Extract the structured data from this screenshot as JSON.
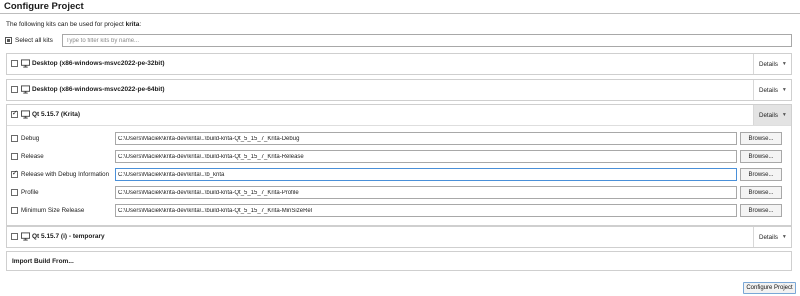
{
  "page": {
    "title": "Configure Project",
    "subtitle_prefix": "The following kits can be used for project",
    "project_name": "krita",
    "subtitle_suffix": ":"
  },
  "select_all": {
    "label": "Select all kits",
    "checked": true
  },
  "filter": {
    "placeholder": "Type to filter kits by name...",
    "value": ""
  },
  "kits": [
    {
      "name": "Desktop (x86-windows-msvc2022-pe-32bit)",
      "checked": false,
      "details_label": "Details",
      "icon": "monitor-icon"
    },
    {
      "name": "Desktop (x86-windows-msvc2022-pe-64bit)",
      "checked": false,
      "details_label": "Details",
      "icon": "monitor-icon"
    },
    {
      "name": "Qt 5.15.7 (Krita)",
      "checked": true,
      "details_label": "Details",
      "icon": "monitor-icon",
      "expanded": true,
      "configs": [
        {
          "label": "Debug",
          "checked": false,
          "path": "C:\\Users\\Maciek\\krita-dev\\krita\\..\\build-krita-Qt_5_15_7_Krita-Debug",
          "browse_label": "Browse..."
        },
        {
          "label": "Release",
          "checked": false,
          "path": "C:\\Users\\Maciek\\krita-dev\\krita\\..\\build-krita-Qt_5_15_7_Krita-Release",
          "browse_label": "Browse..."
        },
        {
          "label": "Release with Debug Information",
          "checked": true,
          "path": "C:\\Users\\Maciek\\krita-dev\\krita\\..\\b_krita",
          "browse_label": "Browse...",
          "focused": true
        },
        {
          "label": "Profile",
          "checked": false,
          "path": "C:\\Users\\Maciek\\krita-dev\\krita\\..\\build-krita-Qt_5_15_7_Krita-Profile",
          "browse_label": "Browse..."
        },
        {
          "label": "Minimum Size Release",
          "checked": false,
          "path": "C:\\Users\\Maciek\\krita-dev\\krita\\..\\build-krita-Qt_5_15_7_Krita-MinSizeRel",
          "browse_label": "Browse..."
        }
      ]
    },
    {
      "name": "Qt 5.15.7 (i) - temporary",
      "checked": false,
      "details_label": "Details",
      "icon": "monitor-icon"
    }
  ],
  "import": {
    "label": "Import Build From..."
  },
  "footer": {
    "configure_label": "Configure Project"
  },
  "colors": {
    "focus": "#4a90d9",
    "border": "#cfcfcf",
    "active_details": "#e3e3e3"
  }
}
